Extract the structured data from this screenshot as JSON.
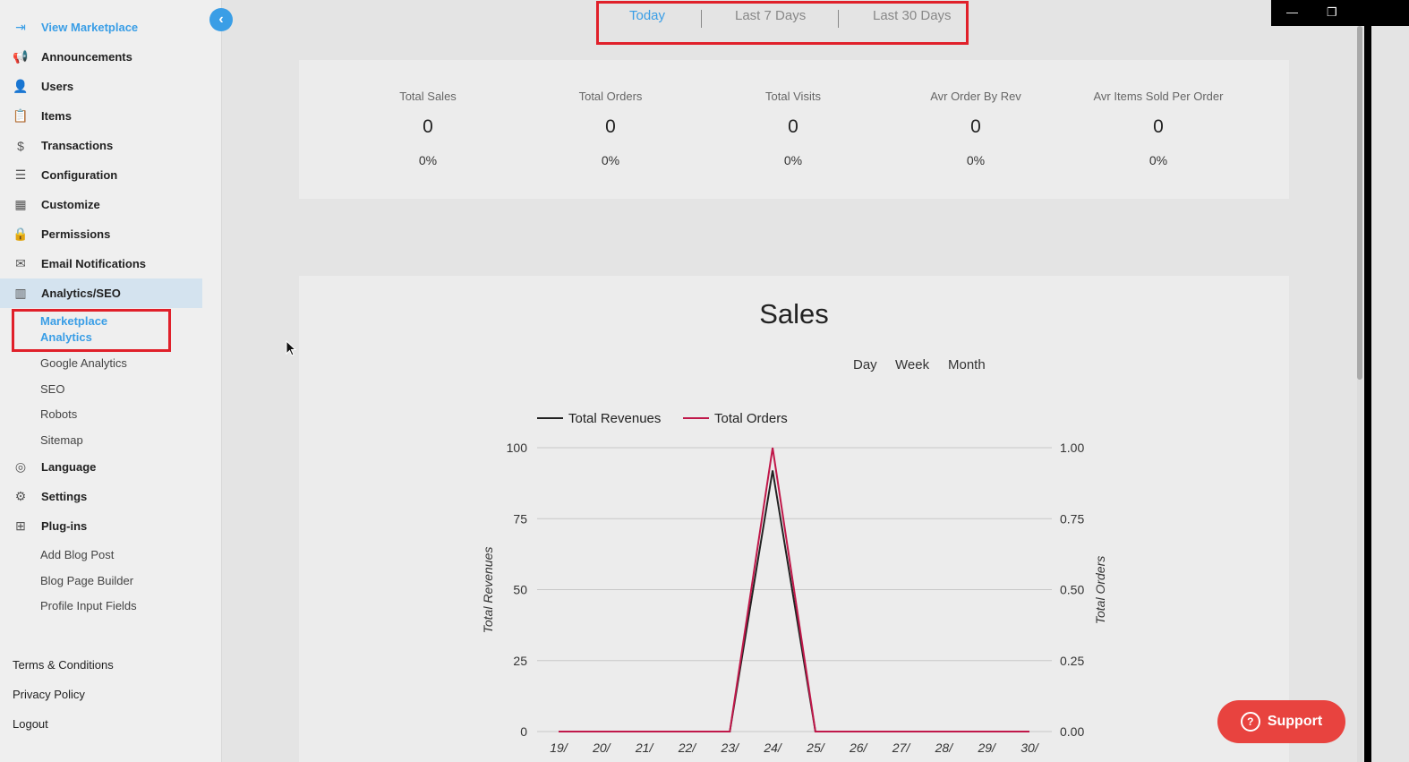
{
  "sidebar": {
    "items": [
      {
        "name": "nav-view-marketplace",
        "icon": "login-icon",
        "glyph": "⇥",
        "label": "View Marketplace"
      },
      {
        "name": "nav-announcements",
        "icon": "megaphone-icon",
        "glyph": "📢",
        "label": "Announcements"
      },
      {
        "name": "nav-users",
        "icon": "user-icon",
        "glyph": "👤",
        "label": "Users"
      },
      {
        "name": "nav-items",
        "icon": "clipboard-icon",
        "glyph": "📋",
        "label": "Items"
      },
      {
        "name": "nav-transactions",
        "icon": "dollar-icon",
        "glyph": "$",
        "label": "Transactions"
      },
      {
        "name": "nav-configuration",
        "icon": "sliders-icon",
        "glyph": "☰",
        "label": "Configuration"
      },
      {
        "name": "nav-customize",
        "icon": "grid-icon",
        "glyph": "▦",
        "label": "Customize"
      },
      {
        "name": "nav-permissions",
        "icon": "lock-icon",
        "glyph": "🔒",
        "label": "Permissions"
      },
      {
        "name": "nav-email-notifications",
        "icon": "envelope-icon",
        "glyph": "✉",
        "label": "Email Notifications"
      },
      {
        "name": "nav-analytics-seo",
        "icon": "bar-chart-icon",
        "glyph": "▥",
        "label": "Analytics/SEO"
      },
      {
        "name": "nav-language",
        "icon": "translate-icon",
        "glyph": "◎",
        "label": "Language"
      },
      {
        "name": "nav-settings",
        "icon": "gear-icon",
        "glyph": "⚙",
        "label": "Settings"
      },
      {
        "name": "nav-plugins",
        "icon": "plugin-icon",
        "glyph": "⊞",
        "label": "Plug-ins"
      }
    ],
    "analytics_sub": [
      "Marketplace Analytics",
      "Google Analytics",
      "SEO",
      "Robots",
      "Sitemap"
    ],
    "marketplace_analytics_lines": [
      "Marketplace",
      "Analytics"
    ],
    "plugins_sub": [
      "Add Blog Post",
      "Blog Page Builder",
      "Profile Input Fields"
    ],
    "footer": [
      "Terms & Conditions",
      "Privacy Policy",
      "Logout"
    ]
  },
  "header": {
    "tabs": [
      "Today",
      "Last 7 Days",
      "Last 30 Days"
    ],
    "active_tab": "Today"
  },
  "stats": [
    {
      "title": "Total Sales",
      "value": "0",
      "percent": "0%"
    },
    {
      "title": "Total Orders",
      "value": "0",
      "percent": "0%"
    },
    {
      "title": "Total Visits",
      "value": "0",
      "percent": "0%"
    },
    {
      "title": "Avr Order By Rev",
      "value": "0",
      "percent": "0%"
    },
    {
      "title": "Avr Items Sold Per Order",
      "value": "0",
      "percent": "0%"
    }
  ],
  "sales": {
    "title": "Sales",
    "ranges": [
      "Day",
      "Week",
      "Month"
    ]
  },
  "support": {
    "label": "Support"
  },
  "colors": {
    "accent": "#3a9ee6",
    "revenue": "#222222",
    "orders": "#c0184a",
    "support": "#e8433f",
    "highlight": "#e0202a"
  },
  "chart_data": {
    "type": "line",
    "x": [
      "19/",
      "20/",
      "21/",
      "22/",
      "23/",
      "24/",
      "25/",
      "26/",
      "27/",
      "28/",
      "29/",
      "30/"
    ],
    "series": [
      {
        "name": "Total Revenues",
        "axis": "left",
        "values": [
          0,
          0,
          0,
          0,
          0,
          92,
          0,
          0,
          0,
          0,
          0,
          0
        ]
      },
      {
        "name": "Total Orders",
        "axis": "right",
        "values": [
          0,
          0,
          0,
          0,
          0,
          1,
          0,
          0,
          0,
          0,
          0,
          0
        ]
      }
    ],
    "ylabel": "Total Revenues",
    "y2label": "Total Orders",
    "ylim": [
      0,
      100
    ],
    "y2lim": [
      0,
      1
    ],
    "yticks": [
      "0",
      "25",
      "50",
      "75",
      "100"
    ],
    "y2ticks": [
      "0.00",
      "0.25",
      "0.50",
      "0.75",
      "1.00"
    ],
    "legend": "top",
    "grid": true
  }
}
